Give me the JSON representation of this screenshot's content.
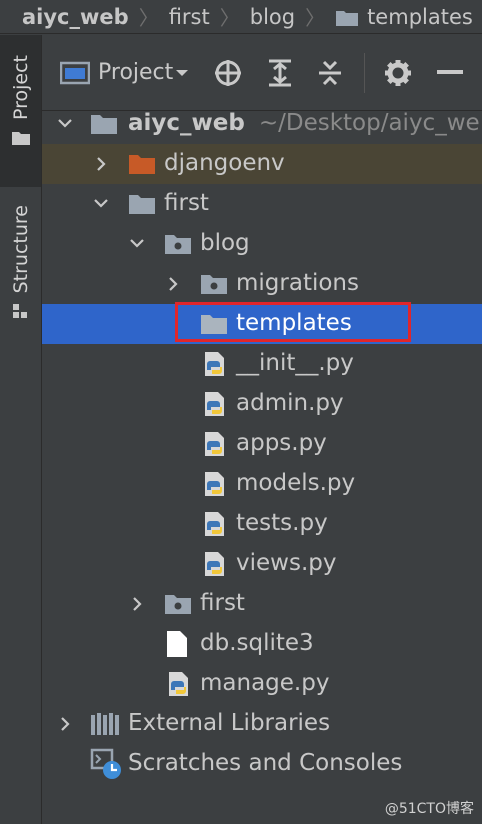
{
  "breadcrumb": {
    "items": [
      "aiyc_web",
      "first",
      "blog",
      "templates"
    ]
  },
  "toolstrip": {
    "project_tab": "Project",
    "structure_tab": "Structure"
  },
  "toolbar": {
    "view_label": "Project",
    "icons": [
      "locate-icon",
      "expand-all-icon",
      "collapse-all-icon",
      "gear-icon",
      "minimize-icon"
    ]
  },
  "tree": {
    "root_name": "aiyc_web",
    "root_path": "~/Desktop/aiyc_we",
    "items": [
      {
        "label": "djangoenv"
      },
      {
        "label": "first"
      },
      {
        "label": "blog"
      },
      {
        "label": "migrations"
      },
      {
        "label": "templates"
      },
      {
        "label": "__init__.py"
      },
      {
        "label": "admin.py"
      },
      {
        "label": "apps.py"
      },
      {
        "label": "models.py"
      },
      {
        "label": "tests.py"
      },
      {
        "label": "views.py"
      },
      {
        "label": "first"
      },
      {
        "label": "db.sqlite3"
      },
      {
        "label": "manage.py"
      },
      {
        "label": "External Libraries"
      },
      {
        "label": "Scratches and Consoles"
      }
    ],
    "selected": "templates"
  },
  "colors": {
    "background": "#3c3f41",
    "selection": "#2f65ca",
    "highlight_box": "#e0262b",
    "excluded_folder": "#c75a27"
  },
  "watermark": "@51CTO博客"
}
